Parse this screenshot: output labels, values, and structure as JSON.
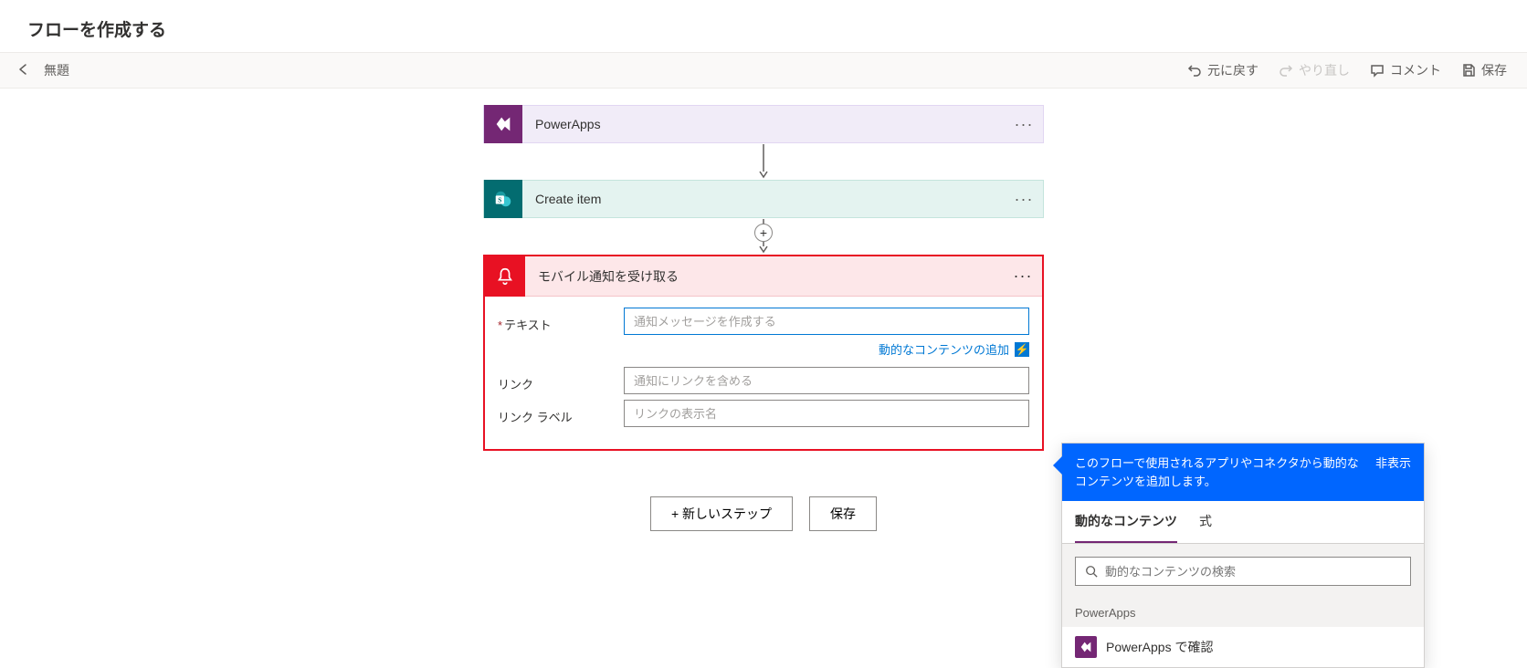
{
  "header": {
    "title": "フローを作成する"
  },
  "toolbar": {
    "flow_name": "無題",
    "undo": "元に戻す",
    "redo": "やり直し",
    "comment": "コメント",
    "save": "保存"
  },
  "steps": {
    "powerapps": {
      "label": "PowerApps"
    },
    "sharepoint": {
      "label": "Create item"
    },
    "notification": {
      "title": "モバイル通知を受け取る",
      "fields": {
        "text_label": "テキスト",
        "text_placeholder": "通知メッセージを作成する",
        "link_label": "リンク",
        "link_placeholder": "通知にリンクを含める",
        "linklabel_label": "リンク ラベル",
        "linklabel_placeholder": "リンクの表示名"
      },
      "dynamic_add_label": "動的なコンテンツの追加"
    }
  },
  "actions": {
    "new_step": "+ 新しいステップ",
    "save": "保存"
  },
  "dynamic_panel": {
    "description": "このフローで使用されるアプリやコネクタから動的なコンテンツを追加します。",
    "hide": "非表示",
    "tabs": {
      "content": "動的なコンテンツ",
      "expression": "式"
    },
    "search_placeholder": "動的なコンテンツの検索",
    "section": "PowerApps",
    "item": "PowerApps で確認"
  }
}
